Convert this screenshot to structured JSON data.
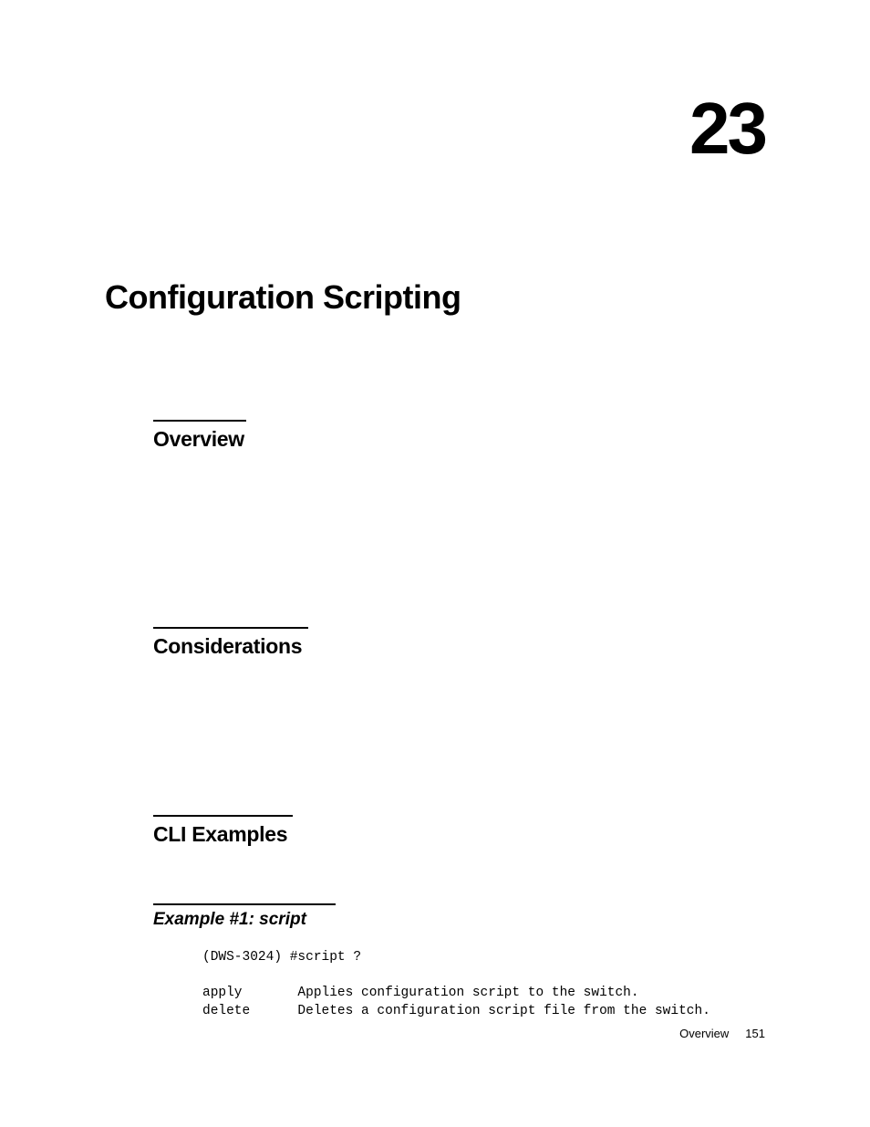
{
  "chapter": {
    "number": "23",
    "title": "Configuration Scripting"
  },
  "sections": {
    "overview": "Overview",
    "considerations": "Considerations",
    "cli_examples": "CLI Examples"
  },
  "subsection": {
    "example1_title": "Example #1: script"
  },
  "code": {
    "line1": "(DWS-3024) #script ?",
    "line2": "",
    "line3": "apply       Applies configuration script to the switch.",
    "line4": "delete      Deletes a configuration script file from the switch."
  },
  "footer": {
    "section_label": "Overview",
    "page_number": "151"
  }
}
